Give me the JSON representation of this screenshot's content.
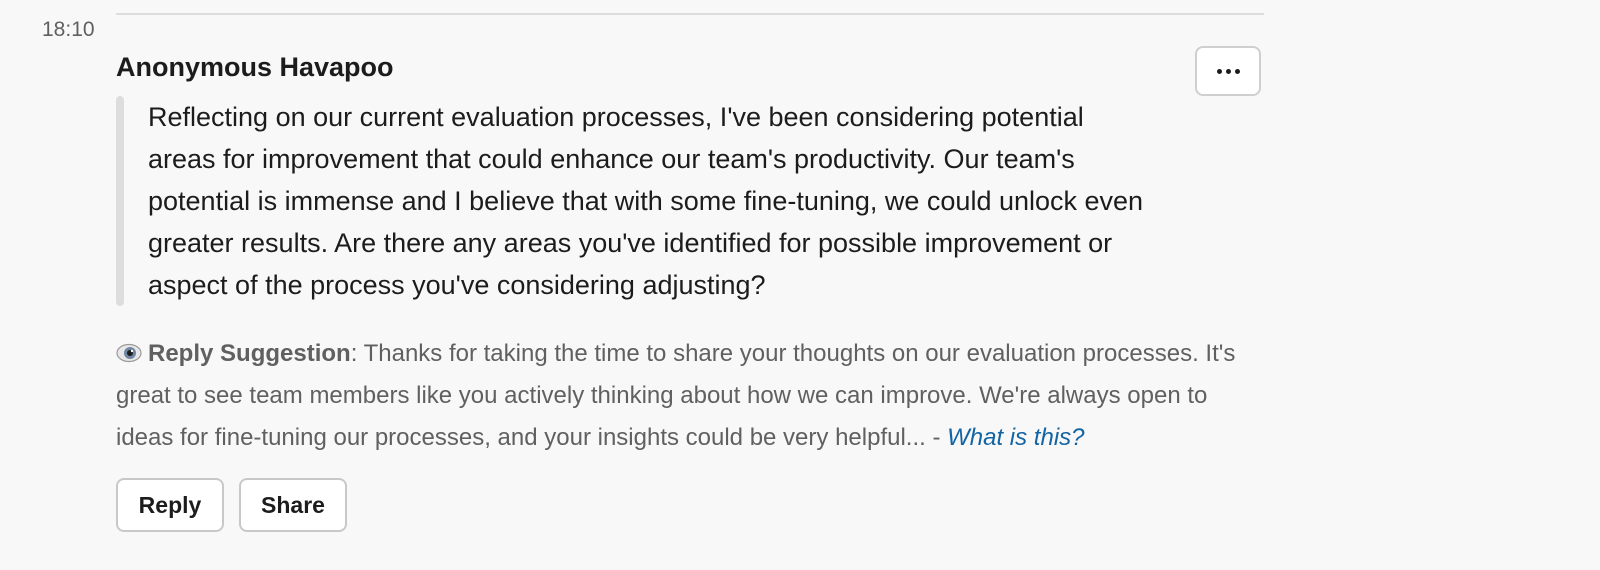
{
  "message": {
    "timestamp": "18:10",
    "author": "Anonymous Havapoo",
    "body": "Reflecting on our current evaluation processes, I've been considering potential areas for improvement that could enhance our team's productivity. Our team's potential is immense and I believe that with some fine-tuning, we could unlock even greater results. Are there any areas you've identified for possible improvement or aspect of the process you've considering adjusting?",
    "more_actions_icon": "ellipsis-icon"
  },
  "suggestion": {
    "icon": "eye-icon",
    "label": "Reply Suggestion",
    "separator": ": ",
    "text": "Thanks for taking the time to share your thoughts on our evaluation processes. It's great to see team members like you actively thinking about how we can improve. We're always open to ideas for fine-tuning our processes, and your insights could be very helpful... - ",
    "link": "What is this?"
  },
  "actions": {
    "reply_label": "Reply",
    "share_label": "Share"
  },
  "colors": {
    "background": "#f8f8f8",
    "text_primary": "#1d1c1d",
    "text_secondary": "#616061",
    "link": "#1264a3",
    "quote_bar": "#dddddd"
  }
}
